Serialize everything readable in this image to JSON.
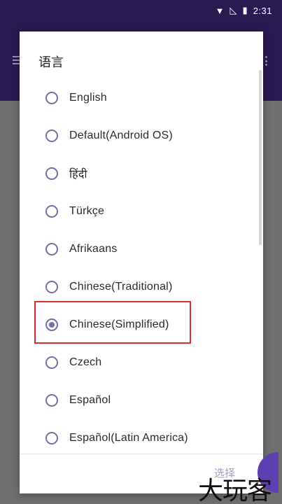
{
  "status_bar": {
    "time": "2:31",
    "icons": [
      "wifi-icon",
      "signal-off-icon",
      "battery-icon"
    ]
  },
  "dialog": {
    "title": "语言",
    "options": [
      {
        "label": "English",
        "checked": false
      },
      {
        "label": "Default(Android OS)",
        "checked": false
      },
      {
        "label": "हिंदी",
        "checked": false
      },
      {
        "label": "Türkçe",
        "checked": false
      },
      {
        "label": "Afrikaans",
        "checked": false
      },
      {
        "label": "Chinese(Traditional)",
        "checked": false
      },
      {
        "label": "Chinese(Simplified)",
        "checked": true
      },
      {
        "label": "Czech",
        "checked": false
      },
      {
        "label": "Español",
        "checked": false
      },
      {
        "label": "Español(Latin America)",
        "checked": false
      }
    ],
    "select_label": "选择"
  },
  "watermark": "大玩客",
  "colors": {
    "appbar": "#2a1a52",
    "radio": "#7a6aa8",
    "highlight": "#d9302f",
    "select": "#a79ac8"
  }
}
